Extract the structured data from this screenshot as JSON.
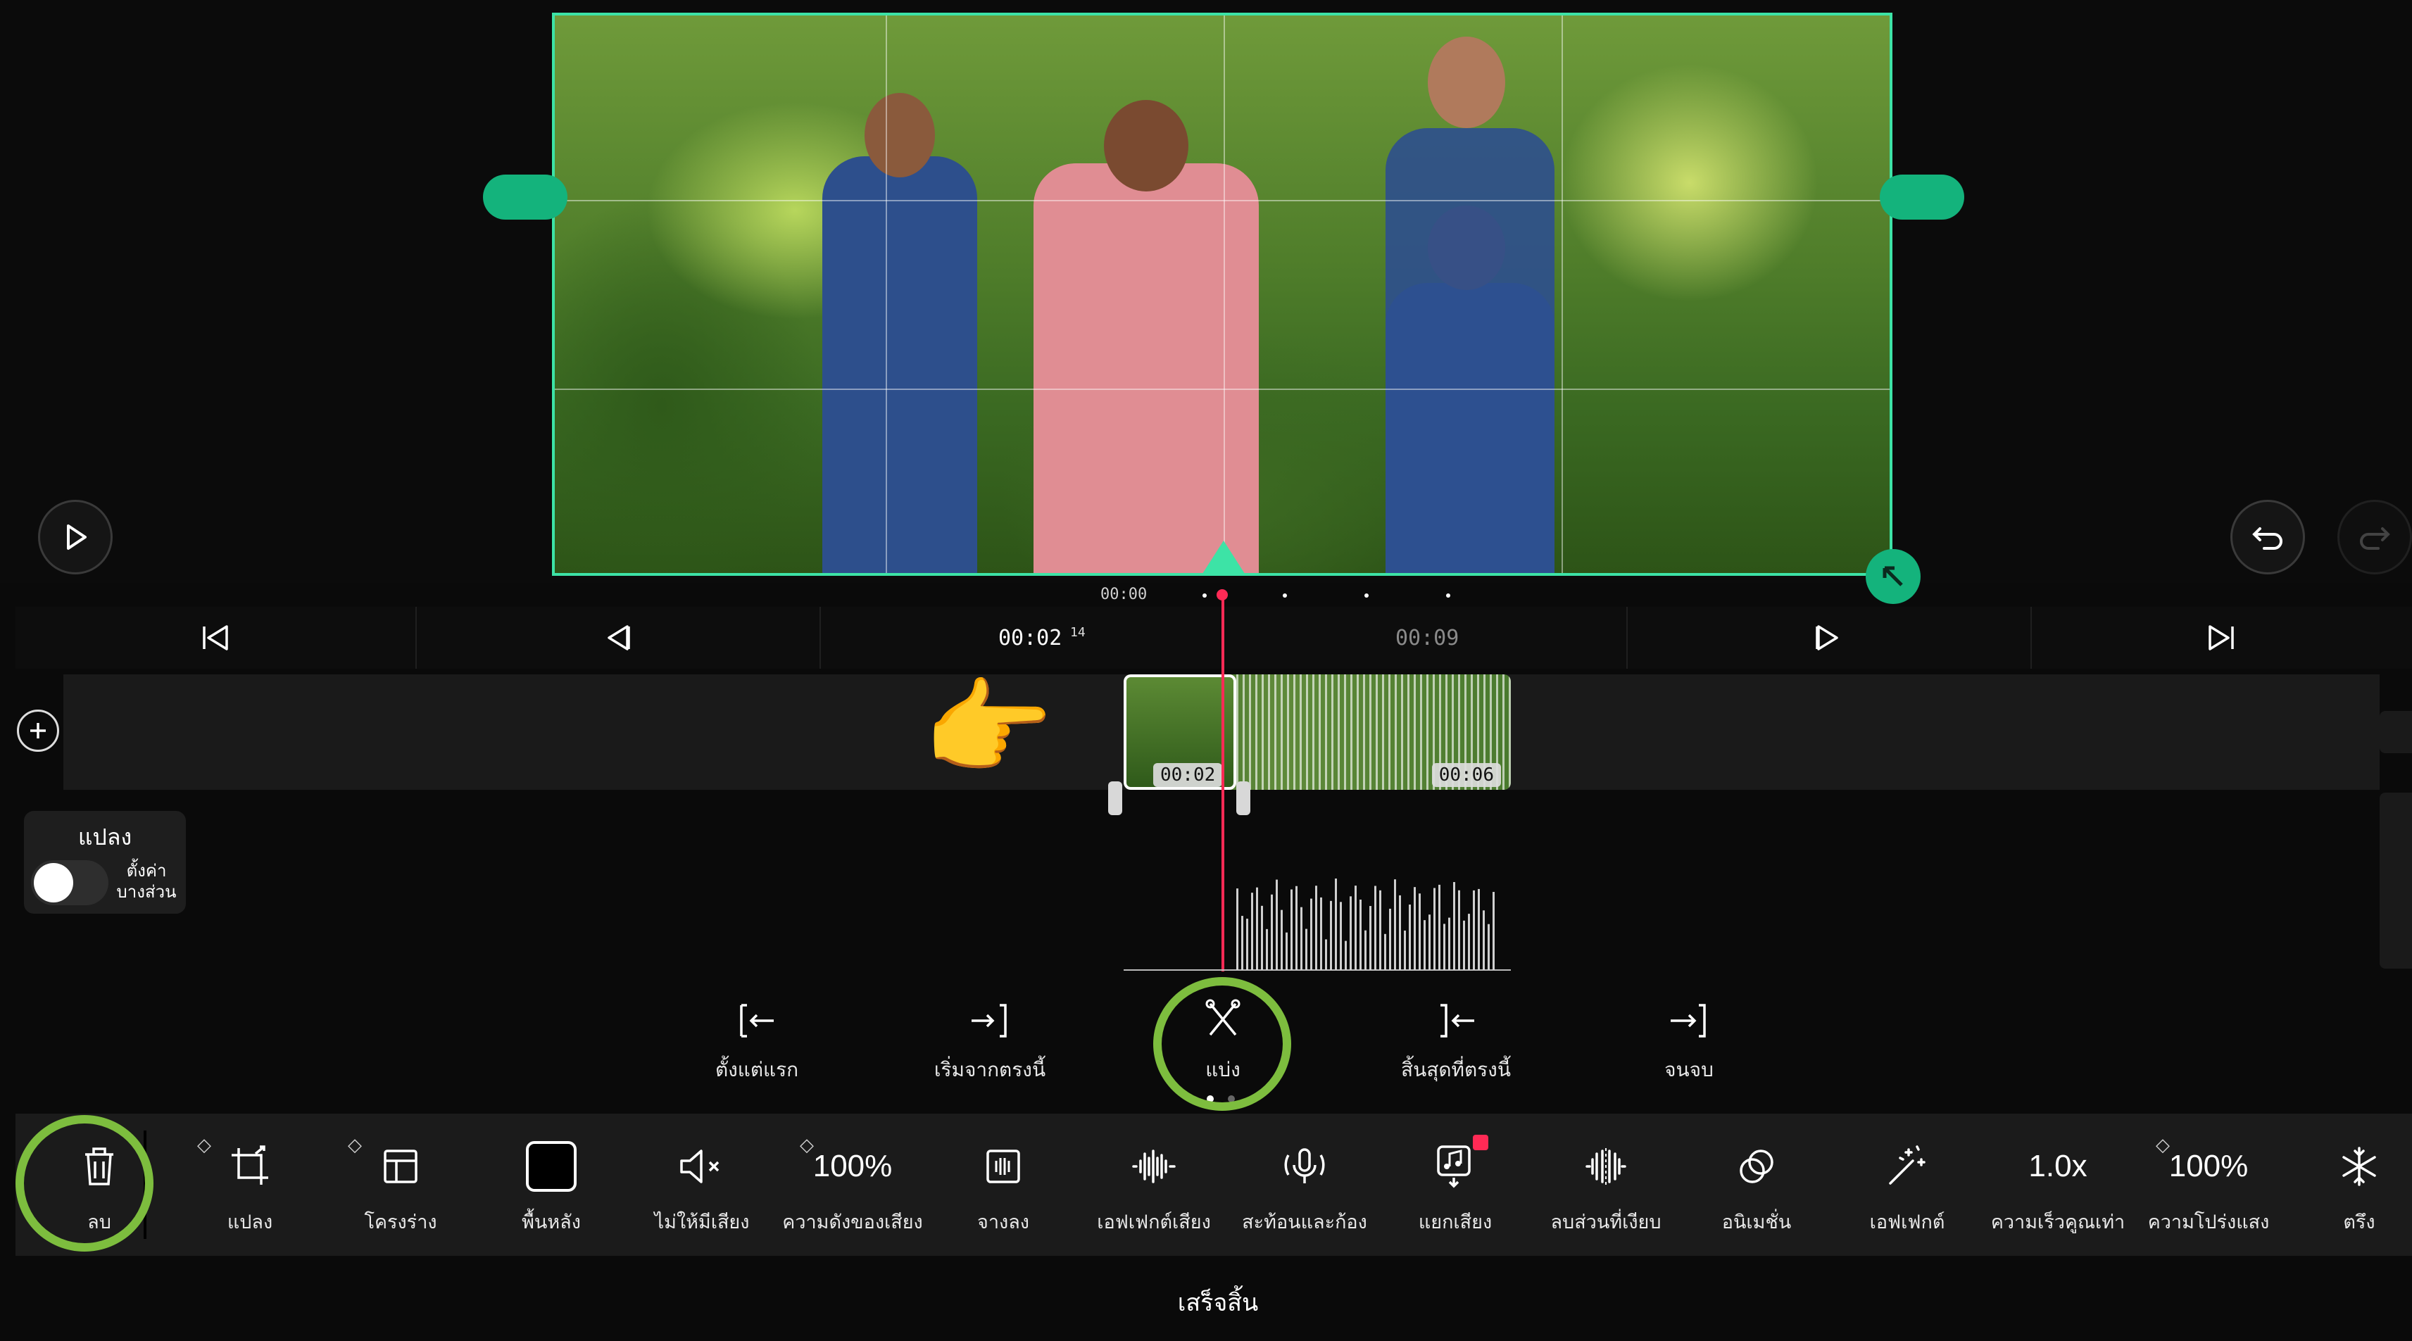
{
  "timeline": {
    "ruler_start": "00:00",
    "current_time": "00:02",
    "current_frame": "14",
    "total_time": "00:09",
    "clip_left_time": "00:02",
    "clip_right_time": "00:06"
  },
  "transform_panel": {
    "title": "แปลง",
    "toggle_label": "ตั้งค่า\nบางส่วน"
  },
  "edit_actions": [
    {
      "label": "ตั้งแต่แรก",
      "icon": "trim-from-start-icon"
    },
    {
      "label": "เริ่มจากตรงนี้",
      "icon": "start-from-here-icon"
    },
    {
      "label": "แบ่ง",
      "icon": "split-scissors-icon"
    },
    {
      "label": "สิ้นสุดที่ตรงนี้",
      "icon": "end-here-icon"
    },
    {
      "label": "จนจบ",
      "icon": "trim-to-end-icon"
    }
  ],
  "toolbar": [
    {
      "label": "ลบ",
      "icon": "trash-icon"
    },
    {
      "label": "แปลง",
      "icon": "crop-transform-icon"
    },
    {
      "label": "โครงร่าง",
      "icon": "layout-icon"
    },
    {
      "label": "พื้นหลัง",
      "icon": "background-square-icon"
    },
    {
      "label": "ไม่ให้มีเสียง",
      "icon": "mute-icon"
    },
    {
      "label": "ความดังของเสียง",
      "value": "100%"
    },
    {
      "label": "จางลง",
      "icon": "fade-icon"
    },
    {
      "label": "เอฟเฟกต์เสียง",
      "icon": "audio-effect-icon"
    },
    {
      "label": "สะท้อนและก้อง",
      "icon": "echo-mic-icon"
    },
    {
      "label": "แยกเสียง",
      "icon": "extract-audio-icon"
    },
    {
      "label": "ลบส่วนที่เงียบ",
      "icon": "remove-silence-icon"
    },
    {
      "label": "อนิเมชั่น",
      "icon": "animation-icon"
    },
    {
      "label": "เอฟเฟกต์",
      "icon": "magic-wand-icon"
    },
    {
      "label": "ความเร็วคูณเท่า",
      "value": "1.0x"
    },
    {
      "label": "ความโปร่งแสง",
      "value": "100%"
    },
    {
      "label": "ตรึง",
      "icon": "snowflake-freeze-icon"
    }
  ],
  "done_label": "เสร็จสิ้น",
  "pointer_emoji": "👉",
  "colors": {
    "accent": "#3de3a6",
    "playhead": "#ff2a55",
    "annotation": "#7dbd3e"
  }
}
